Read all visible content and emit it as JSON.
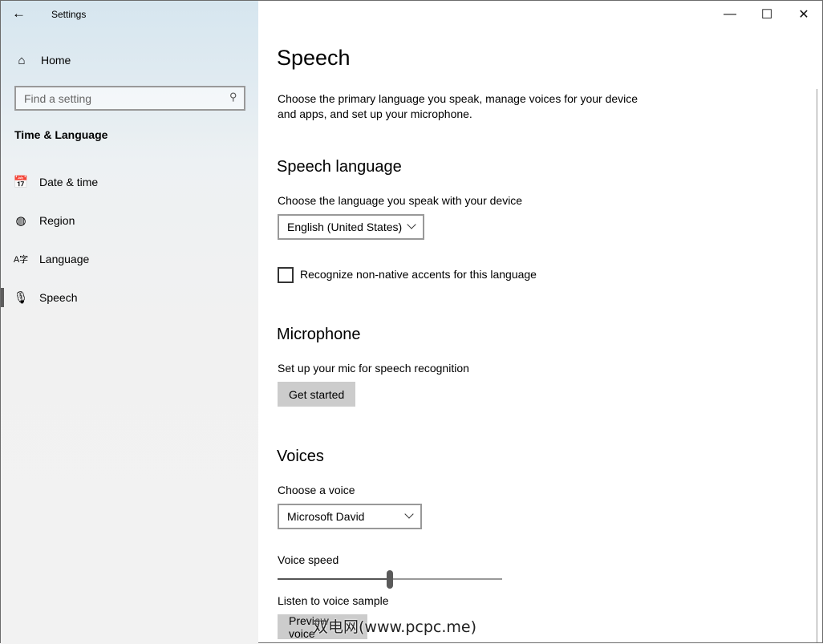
{
  "window": {
    "title": "Settings"
  },
  "sidebar": {
    "home": "Home",
    "search_placeholder": "Find a setting",
    "section": "Time & Language",
    "items": [
      {
        "label": "Date & time",
        "icon": "calendar-clock-icon"
      },
      {
        "label": "Region",
        "icon": "globe-icon"
      },
      {
        "label": "Language",
        "icon": "language-icon"
      },
      {
        "label": "Speech",
        "icon": "microphone-icon",
        "selected": true
      }
    ]
  },
  "main": {
    "title": "Speech",
    "intro": "Choose the primary language you speak, manage voices for your device and apps, and set up your microphone.",
    "speech_language": {
      "heading": "Speech language",
      "label": "Choose the language you speak with your device",
      "value": "English (United States)",
      "checkbox_label": "Recognize non-native accents for this language",
      "checkbox_checked": false
    },
    "microphone": {
      "heading": "Microphone",
      "label": "Set up your mic for speech recognition",
      "button": "Get started"
    },
    "voices": {
      "heading": "Voices",
      "label": "Choose a voice",
      "value": "Microsoft David",
      "speed_label": "Voice speed",
      "speed_percent": 50,
      "sample_label": "Listen to voice sample",
      "preview_button": "Preview voice"
    }
  },
  "watermark": "双电网(www.pcpc.me)"
}
